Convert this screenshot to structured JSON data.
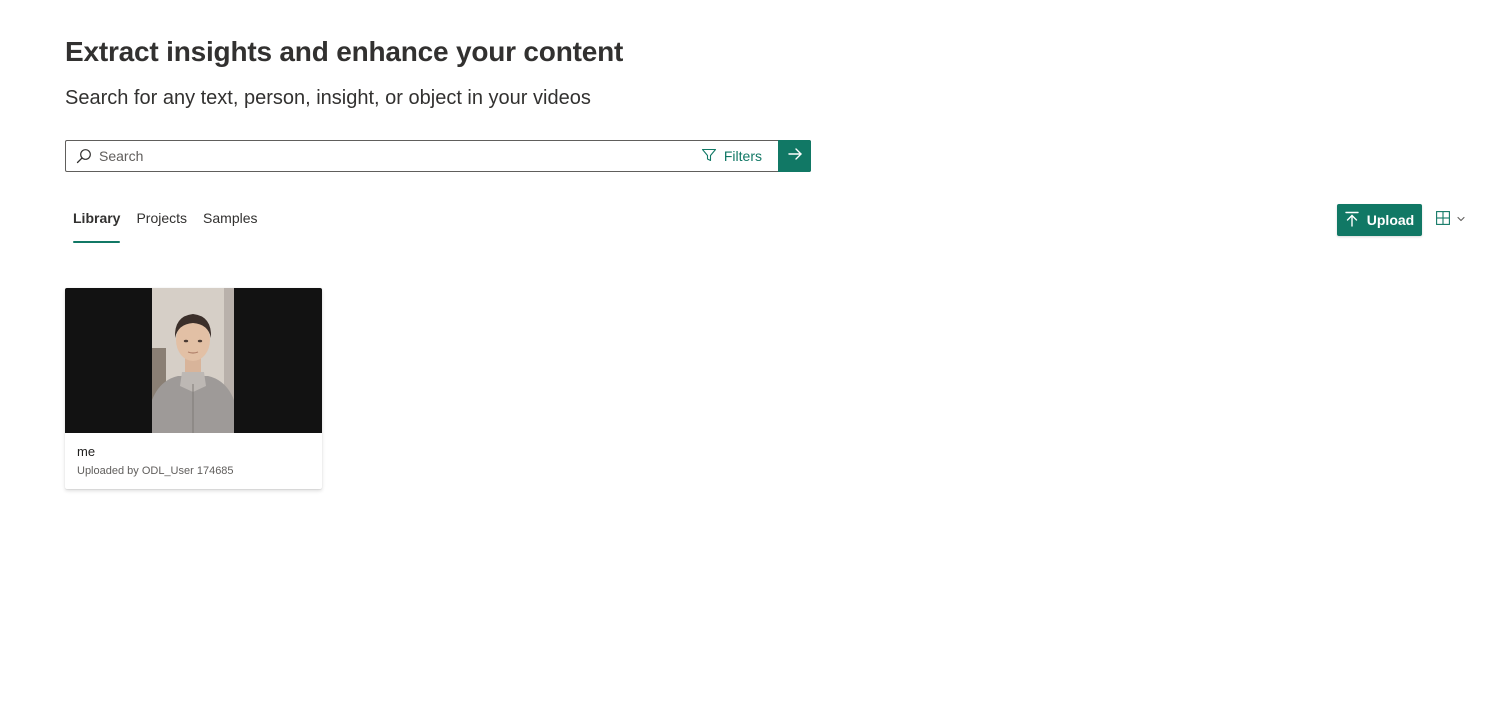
{
  "hero": {
    "title": "Extract insights and enhance your content",
    "subtitle": "Search for any text, person, insight, or object in your videos"
  },
  "search": {
    "placeholder": "Search",
    "value": "",
    "filters_label": "Filters",
    "icon": "search-icon",
    "submit_icon": "arrow-right-icon"
  },
  "tabs": [
    {
      "label": "Library",
      "active": true
    },
    {
      "label": "Projects",
      "active": false
    },
    {
      "label": "Samples",
      "active": false
    }
  ],
  "toolbar": {
    "upload_label": "Upload",
    "upload_icon": "upload-icon",
    "view_icon": "grid-view-icon"
  },
  "videos": [
    {
      "title": "me",
      "meta": "Uploaded by ODL_User 174685"
    }
  ],
  "colors": {
    "accent": "#117865",
    "text": "#323130",
    "thumb_background": "#121212"
  }
}
